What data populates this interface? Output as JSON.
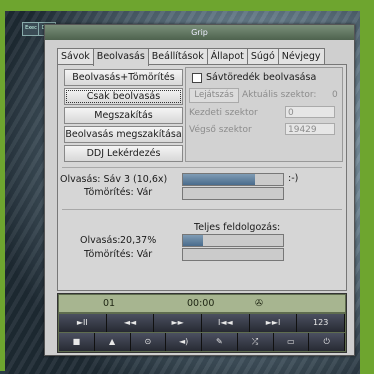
{
  "window": {
    "title": "Grip"
  },
  "desktop": {
    "icons": [
      "Exec",
      "DVD"
    ]
  },
  "tabs": [
    {
      "label": "Sávok",
      "active": false
    },
    {
      "label": "Beolvasás",
      "active": true
    },
    {
      "label": "Beállítások",
      "active": false
    },
    {
      "label": "Állapot",
      "active": false
    },
    {
      "label": "Súgó",
      "active": false
    },
    {
      "label": "Névjegy",
      "active": false
    }
  ],
  "buttons": [
    {
      "label": "Beolvasás+Tömörítés",
      "focused": false
    },
    {
      "label": "Csak beolvasás",
      "focused": true
    },
    {
      "label": "Megszakítás",
      "focused": false
    },
    {
      "label": "Beolvasás megszakítása",
      "focused": false
    },
    {
      "label": "DDJ Lekérdezés",
      "focused": false
    }
  ],
  "partial": {
    "checkbox_label": "Sávtöredék beolvasása",
    "checked": false,
    "play_button": "Lejátszás",
    "current_label": "Aktuális szektor:",
    "current_value": "0",
    "start_label": "Kezdeti szektor",
    "start_value": "0",
    "end_label": "Végső szektor",
    "end_value": "19429"
  },
  "status": {
    "read_label": "Olvasás: Sáv 3 (10,6x)",
    "read_progress": 0.72,
    "smiley": ":-)",
    "encode_label": "Tömörítés: Vár",
    "encode_progress": 0
  },
  "overall": {
    "title": "Teljes feldolgozás:",
    "read_label": "Olvasás:",
    "read_percent": "20,37%",
    "read_progress": 0.2037,
    "encode_label": "Tömörítés: Vár",
    "encode_progress": 0
  },
  "player": {
    "track": "01",
    "time": "00:00",
    "icon": "cd-icon",
    "row1": [
      "play-pause",
      "rewind",
      "fast-forward",
      "previous-track",
      "next-track",
      "repeat"
    ],
    "row1_glyphs": [
      "►II",
      "◄◄",
      "►►",
      "I◄◄",
      "►►I",
      "123"
    ],
    "row2": [
      "stop",
      "eject",
      "disc",
      "volume",
      "edit",
      "shuffle",
      "window",
      "power"
    ],
    "row2_glyphs": [
      "■",
      "▲",
      "⊙",
      "◄)",
      "✎",
      "⤮",
      "▭",
      "⏻"
    ]
  },
  "colors": {
    "accent_green": "#6ea52f",
    "progress": "#4a6c8c",
    "lcd": "#a7b590"
  }
}
